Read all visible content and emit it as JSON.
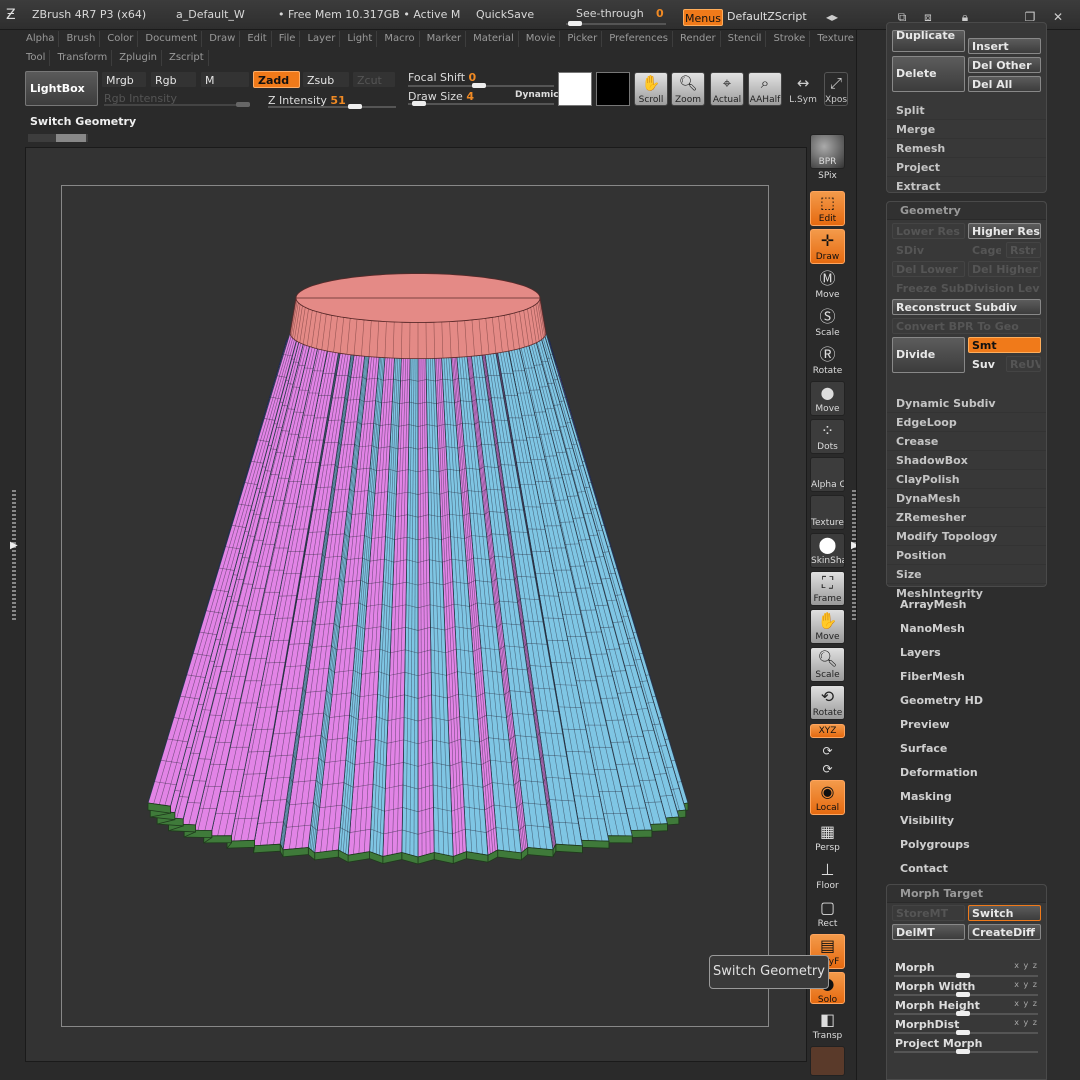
{
  "titlebar": {
    "app_title": "ZBrush 4R7 P3 (x64)",
    "document": "a_Default_W",
    "memory": "• Free Mem 10.317GB • Active M",
    "quicksave": "QuickSave",
    "see_through_label": "See-through",
    "see_through_value": "0",
    "menus_label": "Menus",
    "default_zscript": "DefaultZScript"
  },
  "menubar": {
    "row1": [
      "Alpha",
      "Brush",
      "Color",
      "Document",
      "Draw",
      "Edit",
      "File",
      "Layer",
      "Light",
      "Macro",
      "Marker",
      "Material",
      "Movie",
      "Picker",
      "Preferences",
      "Render",
      "Stencil",
      "Stroke",
      "Texture"
    ],
    "row2": [
      "Tool",
      "Transform",
      "Zplugin",
      "Zscript"
    ]
  },
  "shelf": {
    "lightbox": "LightBox",
    "mrgb": "Mrgb",
    "rgb": "Rgb",
    "m": "M",
    "zadd": "Zadd",
    "zsub": "Zsub",
    "zcut": "Zcut",
    "rgb_intensity": "Rgb Intensity",
    "z_intensity_label": "Z Intensity",
    "z_intensity_value": "51",
    "focal_shift_label": "Focal Shift",
    "focal_shift_value": "0",
    "draw_size_label": "Draw Size",
    "draw_size_value": "4",
    "dynamic": "Dynamic",
    "primary_color": "#ffffff",
    "secondary_color": "#000000",
    "scroll": "Scroll",
    "zoom": "Zoom",
    "actual": "Actual",
    "aahalf": "AAHalf",
    "lsym": "L.Sym",
    "xpose": "Xpose"
  },
  "left": {
    "switch_geometry": "Switch Geometry"
  },
  "righttools": {
    "bpr": "BPR",
    "spix": "SPix",
    "edit": "Edit",
    "draw": "Draw",
    "move": "Move",
    "scale": "Scale",
    "rotate": "Rotate",
    "move2": "Move",
    "dots": "Dots",
    "alpha": "Alpha C",
    "texture": "Texture",
    "skinsha": "SkinSha",
    "frame": "Frame",
    "move3": "Move",
    "scale3": "Scale",
    "rotate3": "Rotate",
    "xyz": "XYZ",
    "local": "Local",
    "persp": "Persp",
    "floor": "Floor",
    "rect": "Rect",
    "polyf": "PolyF",
    "solo": "Solo",
    "transp": "Transp"
  },
  "subtool_panel": {
    "duplicate": "Duplicate",
    "insert": "Insert",
    "delete": "Delete",
    "del_other": "Del Other",
    "del_all": "Del All",
    "items": [
      "Split",
      "Merge",
      "Remesh",
      "Project",
      "Extract"
    ]
  },
  "geometry_panel": {
    "header": "Geometry",
    "lower_res": "Lower Res",
    "higher_res": "Higher Res",
    "sdiv": "SDiv",
    "cage": "Cage",
    "rstr": "Rstr",
    "del_lower": "Del Lower",
    "del_higher": "Del Higher",
    "freeze": "Freeze SubDivision Level",
    "reconstruct": "Reconstruct Subdiv",
    "convert_bpr": "Convert BPR To Geo",
    "divide": "Divide",
    "smt": "Smt",
    "suv": "Suv",
    "reuv": "ReUV",
    "items": [
      "Dynamic Subdiv",
      "EdgeLoop",
      "Crease",
      "ShadowBox",
      "ClayPolish",
      "DynaMesh",
      "ZRemesher",
      "Modify Topology",
      "Position",
      "Size",
      "MeshIntegrity"
    ]
  },
  "tool_sections": [
    "ArrayMesh",
    "NanoMesh",
    "Layers",
    "FiberMesh",
    "Geometry HD",
    "Preview",
    "Surface",
    "Deformation",
    "Masking",
    "Visibility",
    "Polygroups",
    "Contact"
  ],
  "morph_panel": {
    "header": "Morph Target",
    "storemt": "StoreMT",
    "switch": "Switch",
    "delmt": "DelMT",
    "creatediff": "CreateDiff",
    "sliders": [
      {
        "label": "Morph",
        "xyz": "x y z",
        "level": 0.48
      },
      {
        "label": "Morph Width",
        "xyz": "x y z",
        "level": 0.48
      },
      {
        "label": "Morph Height",
        "xyz": "x y z",
        "level": 0.48
      },
      {
        "label": "MorphDist",
        "xyz": "x y z",
        "level": 0.48
      },
      {
        "label": "Project Morph",
        "xyz": "",
        "level": 0.48
      }
    ]
  },
  "tooltip": "Switch Geometry",
  "colors": {
    "accent": "#f07a1a",
    "mesh_top_band": "#e48a86",
    "mesh_cyan": "#7fc6e4",
    "mesh_pink": "#e284e6",
    "mesh_blue": "#8a9cf0",
    "mesh_edge": "#3f7a3a"
  }
}
